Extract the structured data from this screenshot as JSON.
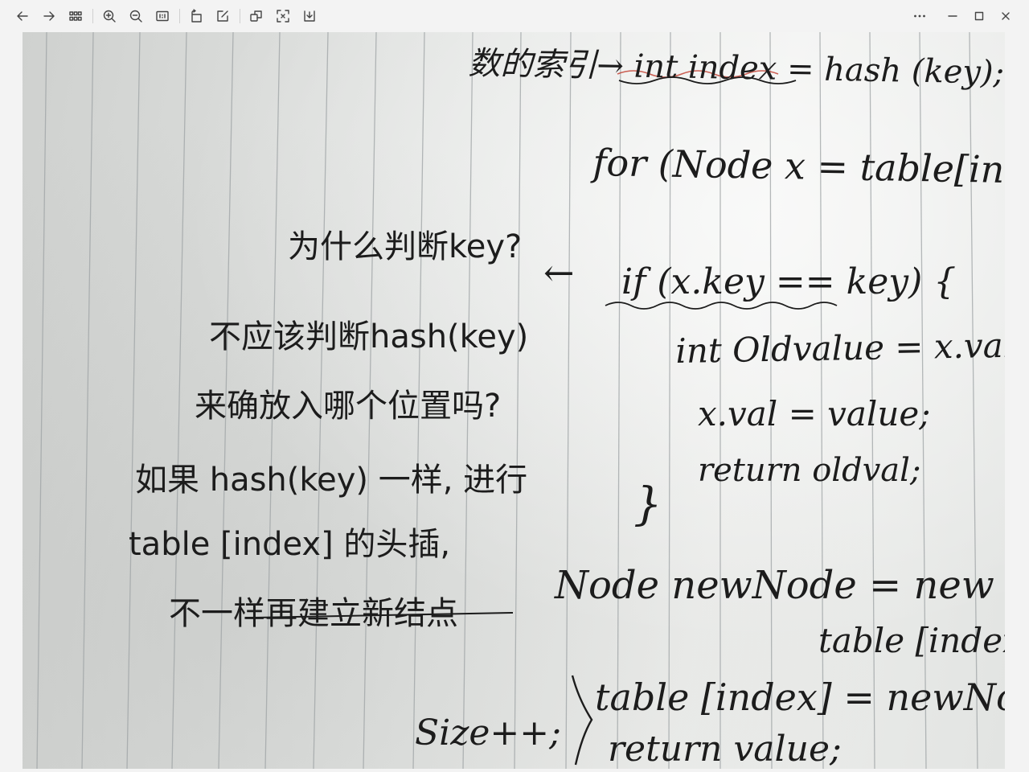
{
  "toolbar": {
    "left_icons": [
      "back-arrow-icon",
      "forward-arrow-icon",
      "thumbnail-grid-icon",
      "zoom-in-icon",
      "zoom-out-icon",
      "actual-size-icon",
      "rotate-icon",
      "edit-icon",
      "copy-icon",
      "ocr-scan-icon",
      "save-download-icon"
    ],
    "right_icons": [
      "more-options-icon",
      "minimize-icon",
      "maximize-icon",
      "close-icon"
    ]
  },
  "note": {
    "line1": "数的索引→ int index = hash (key);",
    "line2": "for (Node x = table[index]; x!=n",
    "q1": "为什么判断key?",
    "arrow": "←",
    "if_line": "if (x.key == key) {",
    "q2": "不应该判断hash(key)",
    "q3": "来确放入哪个位置吗?",
    "q4": "如果 hash(key) 一样, 进行",
    "q5": "table [index] 的头插,",
    "q6": "不一样再建立新结点",
    "oldval_line": "int Oldvalue = x.val;",
    "assign_line": "x.val = value;",
    "return_old": "return oldval;",
    "close_brace": "}",
    "newnode_line": "Node newNode = new Node (",
    "table_index_tail": "table [index]",
    "table_assign": "table [index] = newNode;",
    "size_inc": "Size++;",
    "return_value": "return value;",
    "brace_left": "{",
    "brace_right": ">"
  }
}
